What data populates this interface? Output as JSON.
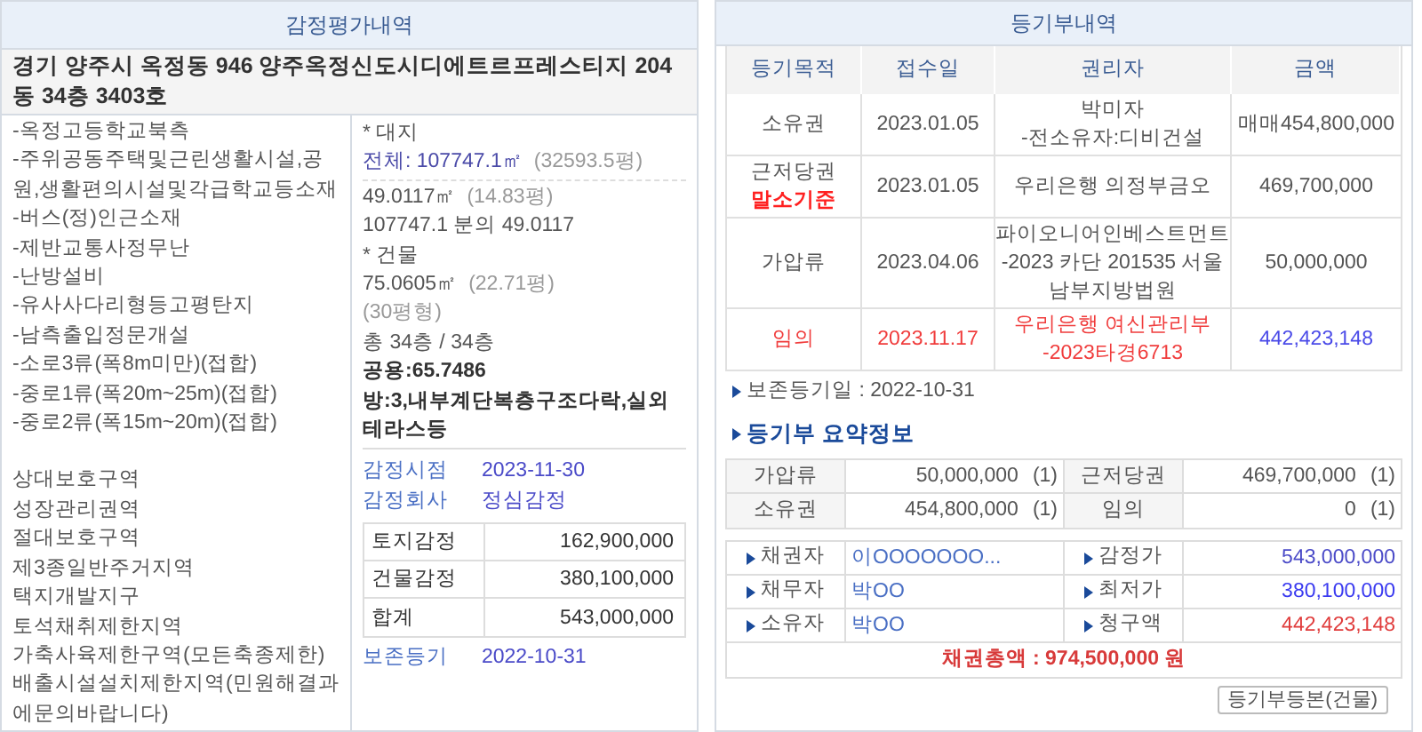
{
  "appraisal": {
    "title": "감정평가내역",
    "address": "경기 양주시 옥정동 946 양주옥정신도시디에트르프레스티지 204동 34층 3403호",
    "features": [
      "-옥정고등학교북측",
      "-주위공동주택및근린생활시설,공원,생활편의시설및각급학교등소재",
      "-버스(정)인근소재",
      "-제반교통사정무난",
      "-난방설비",
      "-유사사다리형등고평탄지",
      "-남측출입정문개설",
      "-소로3류(폭8m미만)(접합)",
      "-중로1류(폭20m~25m)(접합)",
      "-중로2류(폭15m~20m)(접합)"
    ],
    "zones": [
      "상대보호구역",
      "성장관리권역",
      "절대보호구역",
      "제3종일반주거지역",
      "택지개발지구",
      "토석채취제한지역",
      "가축사육제한구역(모든축종제한)",
      "배출시설설치제한지역(민원해결과에문의바랍니다)"
    ],
    "details": [
      {
        "kind": "heading",
        "text": "* 대지"
      },
      {
        "kind": "highlight",
        "text": "전체: 107747.1㎡",
        "note": "(32593.5평)"
      },
      {
        "kind": "plain",
        "text": "49.0117㎡",
        "note": "(14.83평)"
      },
      {
        "kind": "plain",
        "text": "107747.1 분의 49.0117"
      },
      {
        "kind": "heading",
        "text": "* 건물"
      },
      {
        "kind": "plain",
        "text": "75.0605㎡",
        "note": "(22.71평)"
      },
      {
        "kind": "muted",
        "text": "(30평형)"
      },
      {
        "kind": "plain",
        "text": "총 34층 / 34층"
      },
      {
        "kind": "bold",
        "text": "공용:65.7486"
      },
      {
        "kind": "bold",
        "text": "방:3,내부계단복층구조다락,실외테라스등"
      }
    ],
    "info": [
      {
        "label": "감정시점",
        "value": "2023-11-30"
      },
      {
        "label": "감정회사",
        "value": "정심감정"
      }
    ],
    "valuation": [
      {
        "label": "토지감정",
        "value": "162,900,000"
      },
      {
        "label": "건물감정",
        "value": "380,100,000"
      },
      {
        "label": "합계",
        "value": "543,000,000"
      }
    ],
    "registration": {
      "label": "보존등기",
      "value": "2022-10-31"
    }
  },
  "registry": {
    "title": "등기부내역",
    "columns": [
      "등기목적",
      "접수일",
      "권리자",
      "금액"
    ],
    "rows": [
      {
        "purpose": "소유권",
        "date": "2023.01.05",
        "holder": "박미자\n-전소유자:디비건설",
        "amount": "매매454,800,000",
        "highlighted": false
      },
      {
        "purpose": "근저당권",
        "marker": "말소기준",
        "date": "2023.01.05",
        "holder": "우리은행 의정부금오",
        "amount": "469,700,000",
        "highlighted": false
      },
      {
        "purpose": "가압류",
        "date": "2023.04.06",
        "holder": "파이오니어인베스트먼트\n-2023 카단 201535 서울남부지방법원",
        "amount": "50,000,000",
        "highlighted": false
      },
      {
        "purpose": "임의",
        "date": "2023.11.17",
        "holder": "우리은행 여신관리부\n-2023타경6713",
        "amount": "442,423,148",
        "highlighted": true
      }
    ],
    "preservation": "보존등기일 : 2022-10-31",
    "summary_title": "등기부 요약정보",
    "summary": [
      [
        {
          "label": "가압류",
          "amount": "50,000,000",
          "count": "(1)"
        },
        {
          "label": "근저당권",
          "amount": "469,700,000",
          "count": "(1)"
        }
      ],
      [
        {
          "label": "소유권",
          "amount": "454,800,000",
          "count": "(1)"
        },
        {
          "label": "임의",
          "amount": "0",
          "count": "(1)"
        }
      ]
    ],
    "parties": [
      [
        {
          "label": "채권자",
          "value": "이OOOOOOO...",
          "color": "#4a6fc4"
        },
        {
          "label": "감정가",
          "value": "543,000,000",
          "color": "#4b4bc8"
        }
      ],
      [
        {
          "label": "채무자",
          "value": "박OO",
          "color": "#4a6fc4"
        },
        {
          "label": "최저가",
          "value": "380,100,000",
          "color": "#3a3af0"
        }
      ],
      [
        {
          "label": "소유자",
          "value": "박OO",
          "color": "#4a6fc4"
        },
        {
          "label": "청구액",
          "value": "442,423,148",
          "color": "#e03c3c"
        }
      ]
    ],
    "total": "채권총액 : 974,500,000 원",
    "button": "등기부등본(건물)"
  }
}
